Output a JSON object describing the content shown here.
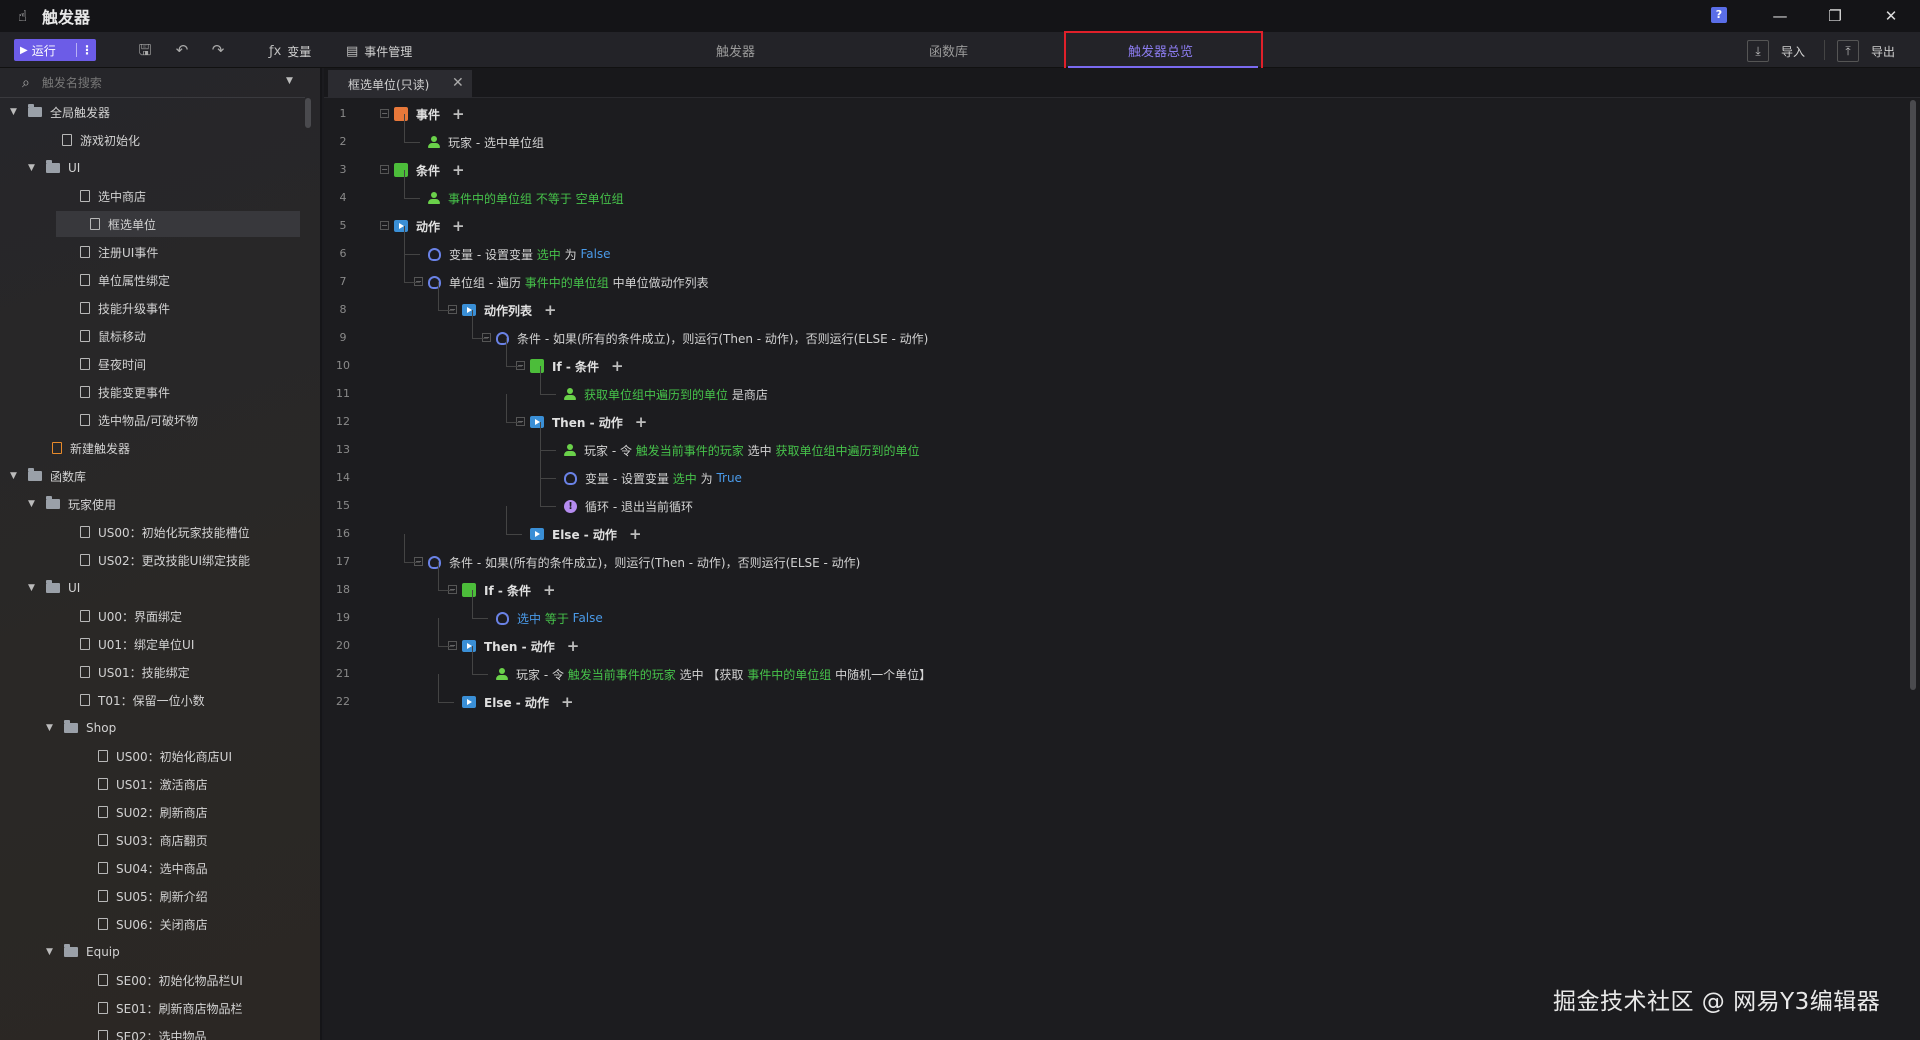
{
  "window": {
    "title": "触发器",
    "help_label": "?",
    "controls": [
      "—",
      "❐",
      "✕"
    ]
  },
  "toolbar": {
    "run_label": "运行",
    "variables_label": "变量",
    "event_mgmt_label": "事件管理",
    "tabs": [
      "触发器",
      "函数库",
      "触发器总览"
    ],
    "active_tab": "触发器总览",
    "import_label": "导入",
    "export_label": "导出"
  },
  "sidebar": {
    "search_placeholder": "触发名搜索",
    "tree": [
      {
        "label": "全局触发器",
        "type": "folder",
        "level": 0,
        "expanded": true
      },
      {
        "label": "游戏初始化",
        "type": "doc",
        "level": 1
      },
      {
        "label": "UI",
        "type": "folder",
        "level": 1,
        "expanded": true
      },
      {
        "label": "选中商店",
        "type": "doc",
        "level": 2
      },
      {
        "label": "框选单位",
        "type": "doc",
        "level": 2,
        "selected": true
      },
      {
        "label": "注册UI事件",
        "type": "doc",
        "level": 2
      },
      {
        "label": "单位属性绑定",
        "type": "doc",
        "level": 2
      },
      {
        "label": "技能升级事件",
        "type": "doc",
        "level": 2
      },
      {
        "label": "鼠标移动",
        "type": "doc",
        "level": 2
      },
      {
        "label": "昼夜时间",
        "type": "doc",
        "level": 2
      },
      {
        "label": "技能变更事件",
        "type": "doc",
        "level": 2
      },
      {
        "label": "选中物品/可破坏物",
        "type": "doc",
        "level": 2
      },
      {
        "label": "新建触发器",
        "type": "new",
        "level": 1
      },
      {
        "label": "函数库",
        "type": "folder",
        "level": 0,
        "expanded": true
      },
      {
        "label": "玩家使用",
        "type": "folder",
        "level": 1,
        "expanded": true
      },
      {
        "label": "US00：初始化玩家技能槽位",
        "type": "doc",
        "level": 2
      },
      {
        "label": "US02：更改技能UI绑定技能",
        "type": "doc",
        "level": 2
      },
      {
        "label": "UI",
        "type": "folder",
        "level": 1,
        "expanded": true
      },
      {
        "label": "U00：界面绑定",
        "type": "doc",
        "level": 2
      },
      {
        "label": "U01：绑定单位UI",
        "type": "doc",
        "level": 2
      },
      {
        "label": "US01：技能绑定",
        "type": "doc",
        "level": 2
      },
      {
        "label": "T01：保留一位小数",
        "type": "doc",
        "level": 2
      },
      {
        "label": "Shop",
        "type": "folder",
        "level": 2,
        "expanded": true
      },
      {
        "label": "US00：初始化商店UI",
        "type": "doc",
        "level": 3
      },
      {
        "label": "US01：激活商店",
        "type": "doc",
        "level": 3
      },
      {
        "label": "SU02：刷新商店",
        "type": "doc",
        "level": 3
      },
      {
        "label": "SU03：商店翻页",
        "type": "doc",
        "level": 3
      },
      {
        "label": "SU04：选中商品",
        "type": "doc",
        "level": 3
      },
      {
        "label": "SU05：刷新介绍",
        "type": "doc",
        "level": 3
      },
      {
        "label": "SU06：关闭商店",
        "type": "doc",
        "level": 3
      },
      {
        "label": "Equip",
        "type": "folder",
        "level": 2,
        "expanded": true
      },
      {
        "label": "SE00：初始化物品栏UI",
        "type": "doc",
        "level": 3
      },
      {
        "label": "SE01：刷新商店物品栏",
        "type": "doc",
        "level": 3
      },
      {
        "label": "SE02：选中物品",
        "type": "doc",
        "level": 3
      }
    ]
  },
  "editor": {
    "tab_label": "框选单位(只读)",
    "lines": [
      {
        "num": "1",
        "indent": 0,
        "icon": "event",
        "fold": true,
        "plus": true,
        "parts": [
          {
            "t": "事件",
            "c": "kw"
          }
        ]
      },
      {
        "num": "2",
        "indent": 1,
        "icon": "player",
        "parts": [
          {
            "t": "玩家 - 选中单位组",
            "c": ""
          }
        ]
      },
      {
        "num": "3",
        "indent": 0,
        "icon": "cond",
        "fold": true,
        "plus": true,
        "parts": [
          {
            "t": "条件",
            "c": "kw"
          }
        ]
      },
      {
        "num": "4",
        "indent": 1,
        "icon": "player",
        "parts": [
          {
            "t": "事件中的单位组",
            "c": "g"
          },
          {
            "t": " 不等于 ",
            "c": "g"
          },
          {
            "t": "空单位组",
            "c": "g"
          }
        ]
      },
      {
        "num": "5",
        "indent": 0,
        "icon": "action",
        "fold": true,
        "plus": true,
        "parts": [
          {
            "t": "动作",
            "c": "kw"
          }
        ]
      },
      {
        "num": "6",
        "indent": 1,
        "icon": "var",
        "parts": [
          {
            "t": "变量 - 设置变量 ",
            "c": ""
          },
          {
            "t": "选中",
            "c": "g"
          },
          {
            "t": " 为 ",
            "c": ""
          },
          {
            "t": "False",
            "c": "b"
          }
        ]
      },
      {
        "num": "7",
        "indent": 1,
        "icon": "var",
        "fold": true,
        "parts": [
          {
            "t": "单位组 - 遍历 ",
            "c": ""
          },
          {
            "t": "事件中的单位组",
            "c": "g"
          },
          {
            "t": " 中单位做动作列表",
            "c": ""
          }
        ]
      },
      {
        "num": "8",
        "indent": 2,
        "icon": "action",
        "fold": true,
        "plus": true,
        "parts": [
          {
            "t": "动作列表",
            "c": "kw"
          }
        ]
      },
      {
        "num": "9",
        "indent": 3,
        "icon": "var",
        "fold": true,
        "parts": [
          {
            "t": "条件 - 如果(所有的条件成立)，则运行(Then - 动作)，否则运行(ELSE - 动作)",
            "c": ""
          }
        ]
      },
      {
        "num": "10",
        "indent": 4,
        "icon": "cond",
        "fold": true,
        "plus": true,
        "parts": [
          {
            "t": "If - 条件",
            "c": "kw"
          }
        ]
      },
      {
        "num": "11",
        "indent": 5,
        "icon": "player",
        "parts": [
          {
            "t": "获取单位组中遍历到的单位",
            "c": "g"
          },
          {
            "t": " 是商店",
            "c": ""
          }
        ]
      },
      {
        "num": "12",
        "indent": 4,
        "icon": "action",
        "fold": true,
        "plus": true,
        "parts": [
          {
            "t": "Then - 动作",
            "c": "kw"
          }
        ]
      },
      {
        "num": "13",
        "indent": 5,
        "icon": "player",
        "parts": [
          {
            "t": "玩家 - 令 ",
            "c": ""
          },
          {
            "t": "触发当前事件的玩家",
            "c": "g"
          },
          {
            "t": " 选中 ",
            "c": ""
          },
          {
            "t": "获取单位组中遍历到的单位",
            "c": "g"
          }
        ]
      },
      {
        "num": "14",
        "indent": 5,
        "icon": "var",
        "parts": [
          {
            "t": "变量 - 设置变量 ",
            "c": ""
          },
          {
            "t": "选中",
            "c": "g"
          },
          {
            "t": " 为 ",
            "c": ""
          },
          {
            "t": "True",
            "c": "b"
          }
        ]
      },
      {
        "num": "15",
        "indent": 5,
        "icon": "loop",
        "parts": [
          {
            "t": "循环 - 退出当前循环",
            "c": ""
          }
        ]
      },
      {
        "num": "16",
        "indent": 4,
        "icon": "action",
        "plus": true,
        "parts": [
          {
            "t": "Else - 动作",
            "c": "kw"
          }
        ]
      },
      {
        "num": "17",
        "indent": 1,
        "icon": "var",
        "fold": true,
        "parts": [
          {
            "t": "条件 - 如果(所有的条件成立)，则运行(Then - 动作)，否则运行(ELSE - 动作)",
            "c": ""
          }
        ]
      },
      {
        "num": "18",
        "indent": 2,
        "icon": "cond",
        "fold": true,
        "plus": true,
        "parts": [
          {
            "t": "If - 条件",
            "c": "kw"
          }
        ]
      },
      {
        "num": "19",
        "indent": 3,
        "icon": "var",
        "parts": [
          {
            "t": "选中",
            "c": "b"
          },
          {
            "t": " 等于 ",
            "c": "g"
          },
          {
            "t": "False",
            "c": "b"
          }
        ]
      },
      {
        "num": "20",
        "indent": 2,
        "icon": "action",
        "fold": true,
        "plus": true,
        "parts": [
          {
            "t": "Then - 动作",
            "c": "kw"
          }
        ]
      },
      {
        "num": "21",
        "indent": 3,
        "icon": "player",
        "parts": [
          {
            "t": "玩家 - 令 ",
            "c": ""
          },
          {
            "t": "触发当前事件的玩家",
            "c": "g"
          },
          {
            "t": " 选中 【获取 ",
            "c": ""
          },
          {
            "t": "事件中的单位组",
            "c": "g"
          },
          {
            "t": " 中随机一个单位】",
            "c": ""
          }
        ]
      },
      {
        "num": "22",
        "indent": 2,
        "icon": "action",
        "plus": true,
        "parts": [
          {
            "t": "Else - 动作",
            "c": "kw"
          }
        ]
      }
    ]
  },
  "watermark": "掘金技术社区 @ 网易Y3编辑器",
  "colors": {
    "accent": "#6c5ce7",
    "highlight_box": "#e0202a",
    "green_token": "#46c24a",
    "blue_token": "#4a9ae8"
  }
}
